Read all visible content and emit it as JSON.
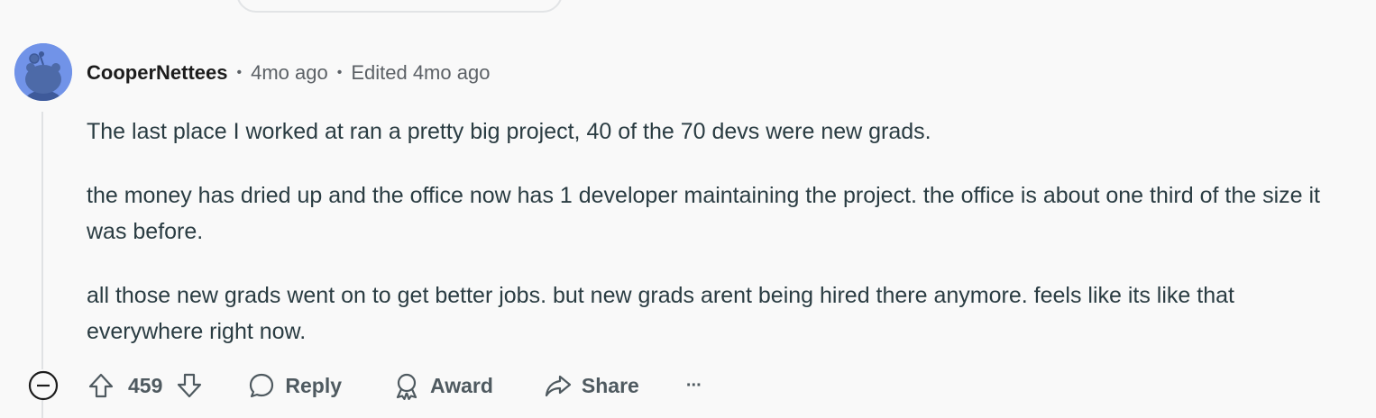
{
  "comment": {
    "author": "CooperNettees",
    "posted": "4mo ago",
    "edited": "Edited 4mo ago",
    "paragraphs": [
      "The last place I worked at ran a pretty big project, 40 of the 70 devs were new grads.",
      "the money has dried up and the office now has 1 developer maintaining the project. the office is about one third of the size it was before.",
      "all those new grads went on to get better jobs. but new grads arent being hired there anymore. feels like its like that everywhere right now."
    ]
  },
  "actions": {
    "score": "459",
    "reply_label": "Reply",
    "award_label": "Award",
    "share_label": "Share",
    "more_label": "···"
  },
  "colors": {
    "background": "#f9f9f9",
    "avatar": "#7193e8",
    "text": "#2a3c42",
    "meta": "#5c6166",
    "thread_line": "#e0e2e4"
  },
  "icons": [
    "avatar-snoo",
    "collapse-icon",
    "upvote-icon",
    "downvote-icon",
    "reply-icon",
    "award-icon",
    "share-icon"
  ]
}
